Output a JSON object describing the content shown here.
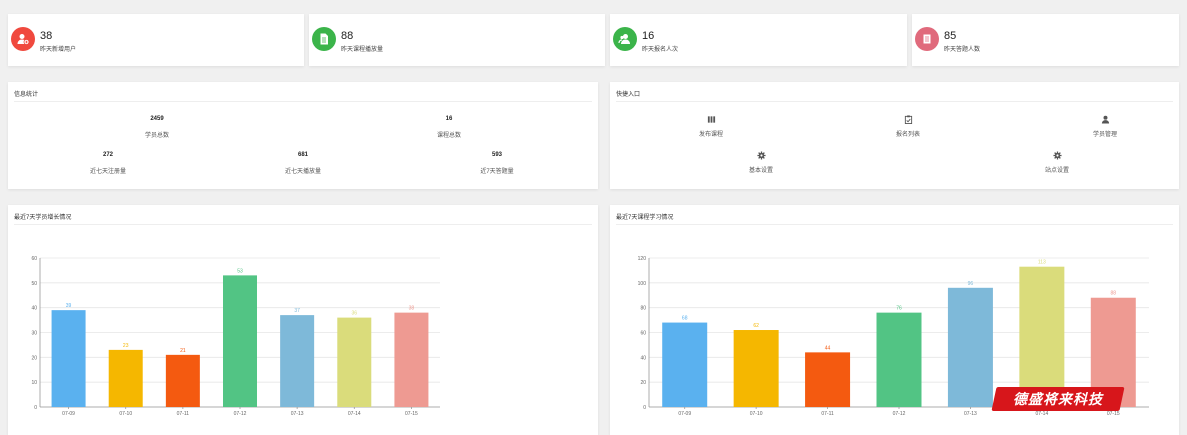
{
  "stats": [
    {
      "value": "38",
      "label": "昨天新增用户",
      "color": "#f0493e",
      "icon": "user-add-icon"
    },
    {
      "value": "88",
      "label": "昨天课程播放量",
      "color": "#3bb44a",
      "icon": "document-icon"
    },
    {
      "value": "16",
      "label": "昨天报名人次",
      "color": "#3bb44a",
      "icon": "users-icon"
    },
    {
      "value": "85",
      "label": "昨天答题人数",
      "color": "#e06a7c",
      "icon": "list-icon"
    }
  ],
  "info": {
    "title": "信息统计",
    "items": [
      {
        "value": "2459",
        "label": "学员总数"
      },
      {
        "value": "16",
        "label": "课程总数"
      },
      {
        "value": "272",
        "label": "近七天注册量"
      },
      {
        "value": "681",
        "label": "近七天播放量"
      },
      {
        "value": "593",
        "label": "近7天答题量"
      }
    ]
  },
  "quick": {
    "title": "快捷入口",
    "items": [
      {
        "label": "发布课程",
        "icon": "publish-icon"
      },
      {
        "label": "报名列表",
        "icon": "clipboard-icon"
      },
      {
        "label": "学员管理",
        "icon": "user-manage-icon"
      },
      {
        "label": "基本设置",
        "icon": "gear-icon"
      },
      {
        "label": "站点设置",
        "icon": "gear-icon"
      }
    ]
  },
  "watermark": "德盛将来科技",
  "chart_data": [
    {
      "type": "bar",
      "title": "最近7天学员增长情况",
      "categories": [
        "07-09",
        "07-10",
        "07-11",
        "07-12",
        "07-13",
        "07-14",
        "07-15"
      ],
      "values": [
        39,
        23,
        21,
        53,
        37,
        36,
        38
      ],
      "colors": [
        "#5ab1ef",
        "#f5b700",
        "#f45a10",
        "#52c484",
        "#7eb9d9",
        "#dadc7b",
        "#ee9a92"
      ],
      "ylim": [
        0,
        60
      ],
      "yticks": [
        0,
        10,
        20,
        30,
        40,
        50,
        60
      ],
      "grid": true
    },
    {
      "type": "bar",
      "title": "最近7天课程学习情况",
      "categories": [
        "07-09",
        "07-10",
        "07-11",
        "07-12",
        "07-13",
        "07-14",
        "07-15"
      ],
      "values": [
        68,
        62,
        44,
        76,
        96,
        113,
        88
      ],
      "colors": [
        "#5ab1ef",
        "#f5b700",
        "#f45a10",
        "#52c484",
        "#7eb9d9",
        "#dadc7b",
        "#ee9a92"
      ],
      "ylim": [
        0,
        120
      ],
      "yticks": [
        0,
        20,
        40,
        60,
        80,
        100,
        120
      ],
      "grid": true
    }
  ]
}
